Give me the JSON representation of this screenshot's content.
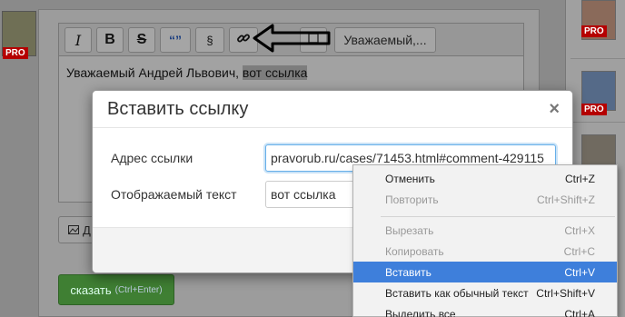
{
  "page": {
    "pro_badge": "PRO"
  },
  "editor": {
    "toolbar": {
      "italic": "I",
      "bold": "B",
      "strike": "S",
      "quote": "“”",
      "paragraph": "§",
      "greeting": "Уважаемый,..."
    },
    "content": {
      "text": "Уважаемый Андрей Львович, ",
      "selected": "вот ссылка"
    },
    "attach_label": "Д",
    "submit_label": "сказать",
    "submit_hint": "(Ctrl+Enter)"
  },
  "modal": {
    "title": "Вставить ссылку",
    "close": "×",
    "url_label": "Адрес ссылки",
    "url_value": "pravorub.ru/cases/71453.html#comment-429115",
    "text_label": "Отображаемый текст",
    "text_value": "вот ссылка"
  },
  "context_menu": {
    "items": [
      {
        "label": "Отменить",
        "shortcut": "Ctrl+Z",
        "state": "enabled"
      },
      {
        "label": "Повторить",
        "shortcut": "Ctrl+Shift+Z",
        "state": "disabled"
      },
      {
        "label": "Вырезать",
        "shortcut": "Ctrl+X",
        "state": "disabled"
      },
      {
        "label": "Копировать",
        "shortcut": "Ctrl+C",
        "state": "disabled"
      },
      {
        "label": "Вставить",
        "shortcut": "Ctrl+V",
        "state": "highlighted"
      },
      {
        "label": "Вставить как обычный текст",
        "shortcut": "Ctrl+Shift+V",
        "state": "enabled"
      },
      {
        "label": "Выделить все",
        "shortcut": "Ctrl+A",
        "state": "enabled"
      }
    ]
  },
  "colors": {
    "highlight": "#3e7fdb",
    "submit": "#3f7f33",
    "pro_badge": "#b50000"
  }
}
